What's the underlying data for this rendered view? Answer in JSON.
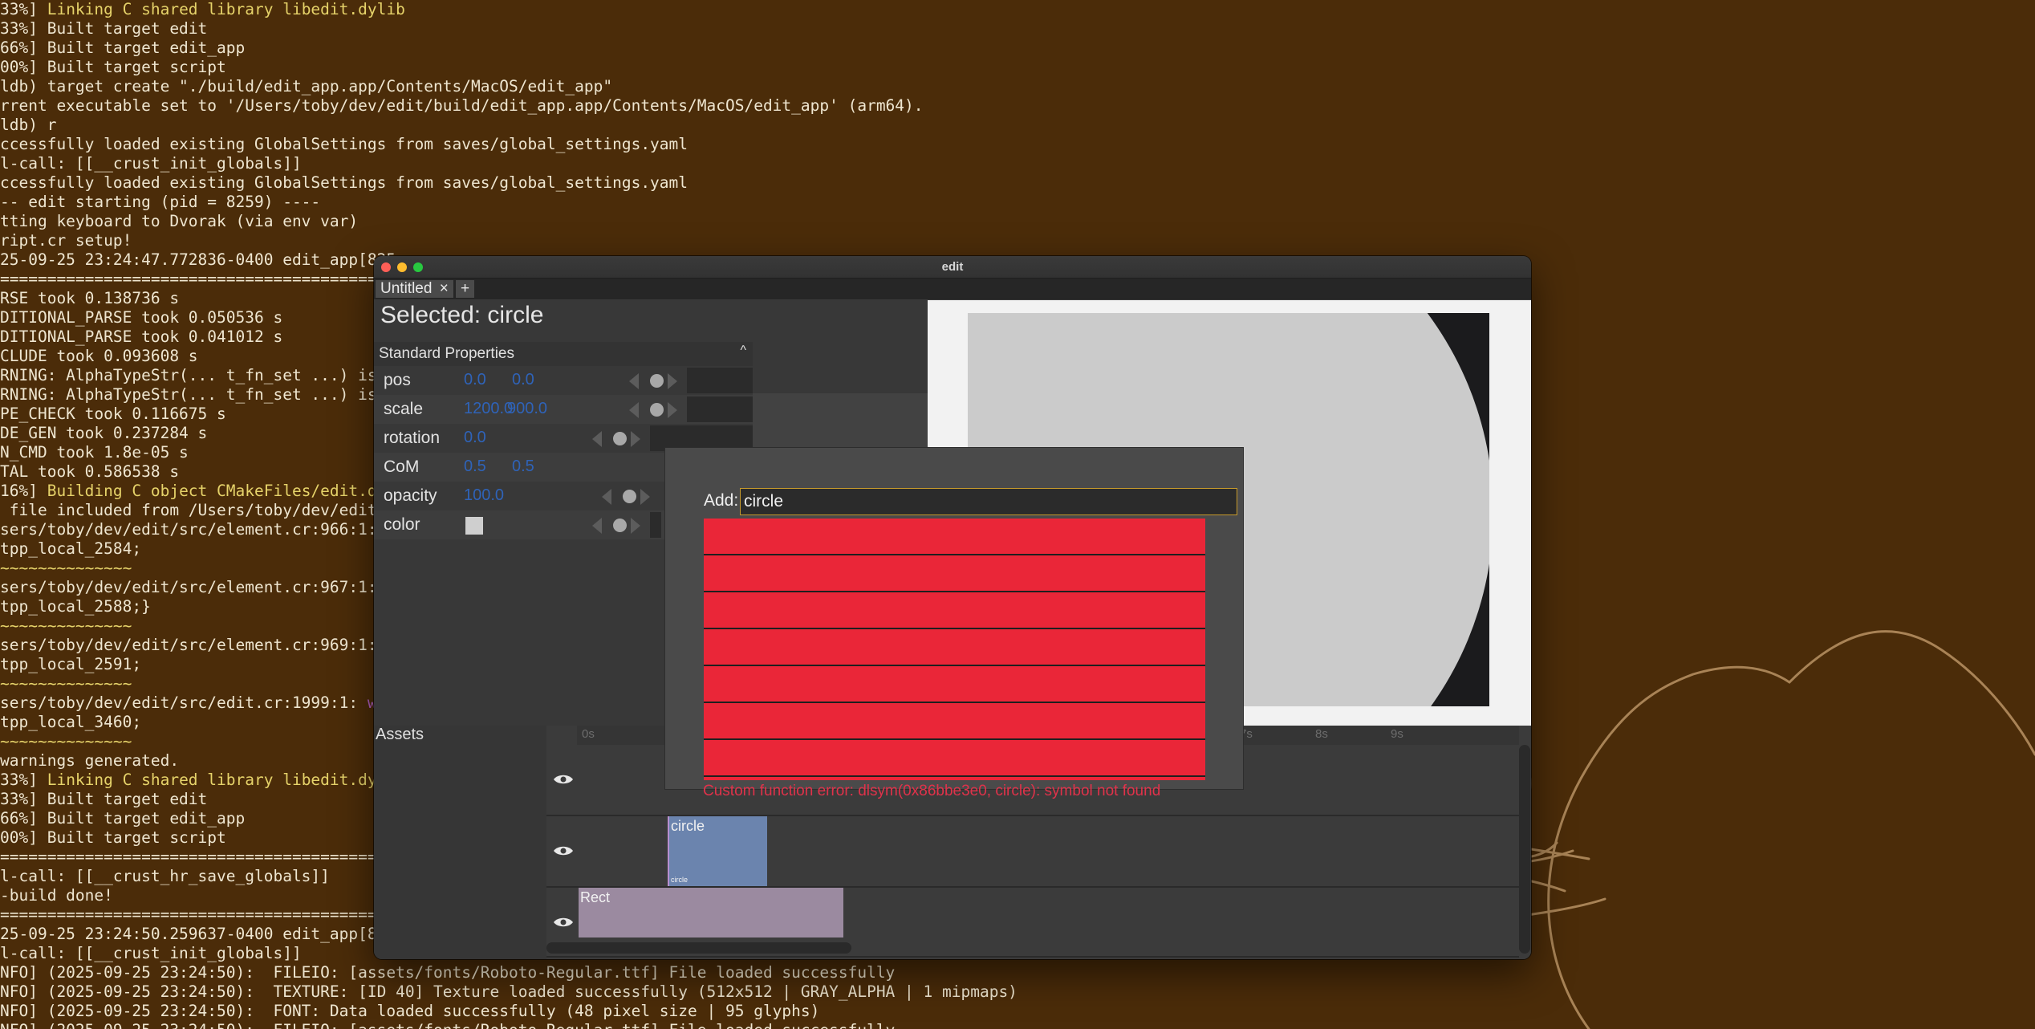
{
  "terminal": {
    "lines": [
      {
        "t": "33%] Linking C shared library libedit.dylib",
        "c": "y",
        "s": 4
      },
      {
        "t": "33%] Built target edit"
      },
      {
        "t": "66%] Built target edit_app"
      },
      {
        "t": "00%] Built target script"
      },
      {
        "t": "ldb) target create \"./build/edit_app.app/Contents/MacOS/edit_app\""
      },
      {
        "t": "rrent executable set to '/Users/toby/dev/edit/build/edit_app.app/Contents/MacOS/edit_app' (arm64)."
      },
      {
        "t": "ldb) r"
      },
      {
        "t": "ccessfully loaded existing GlobalSettings from saves/global_settings.yaml"
      },
      {
        "t": "l-call: [[__crust_init_globals]]"
      },
      {
        "t": "ccessfully loaded existing GlobalSettings from saves/global_settings.yaml"
      },
      {
        "t": "-- edit starting (pid = 8259) ----"
      },
      {
        "t": "tting keyboard to Dvorak (via env var)"
      },
      {
        "t": "ript.cr setup!"
      },
      {
        "t": "25-09-25 23:24:47.772836-0400 edit_app[825"
      },
      {
        "t": "=========================================="
      },
      {
        "t": "RSE took 0.138736 s"
      },
      {
        "t": "DITIONAL_PARSE took 0.050536 s"
      },
      {
        "t": "DITIONAL_PARSE took 0.041012 s"
      },
      {
        "t": "CLUDE took 0.093608 s"
      },
      {
        "t": "RNING: AlphaTypeStr(... t_fn_set ...) is re"
      },
      {
        "t": "RNING: AlphaTypeStr(... t_fn_set ...) is re"
      },
      {
        "t": "PE_CHECK took 0.116675 s"
      },
      {
        "t": "DE_GEN took 0.237284 s"
      },
      {
        "t": "N_CMD took 1.8e-05 s"
      },
      {
        "t": "TAL took 0.586538 s"
      },
      {
        "t": "16%] Building C object CMakeFiles/edit.dir",
        "c": "y",
        "s": 4
      },
      {
        "t": " file included from /Users/toby/dev/edit/o"
      },
      {
        "t": "sers/toby/dev/edit/src/element.cr:966:1: wa",
        "m": 41
      },
      {
        "t": "tpp_local_2584;"
      },
      {
        "t": "~~~~~~~~~~~~~~",
        "c": "y"
      },
      {
        "t": "sers/toby/dev/edit/src/element.cr:967:1: wa",
        "m": 41
      },
      {
        "t": "tpp_local_2588;}"
      },
      {
        "t": "~~~~~~~~~~~~~~",
        "c": "y"
      },
      {
        "t": "sers/toby/dev/edit/src/element.cr:969:1: wa",
        "m": 41
      },
      {
        "t": "tpp_local_2591;"
      },
      {
        "t": "~~~~~~~~~~~~~~",
        "c": "y"
      },
      {
        "t": "sers/toby/dev/edit/src/edit.cr:1999:1: warn",
        "m": 39
      },
      {
        "t": "tpp_local_3460;"
      },
      {
        "t": "~~~~~~~~~~~~~~",
        "c": "y"
      },
      {
        "t": "warnings generated."
      },
      {
        "t": "33%] Linking C shared library libedit.dyli",
        "c": "y",
        "s": 4
      },
      {
        "t": "33%] Built target edit"
      },
      {
        "t": "66%] Built target edit_app"
      },
      {
        "t": "00%] Built target script"
      },
      {
        "t": "=========================================="
      },
      {
        "t": "l-call: [[__crust_hr_save_globals]]"
      },
      {
        "t": "-build done!"
      },
      {
        "t": "=========================================="
      },
      {
        "t": "25-09-25 23:24:50.259637-0400 edit_app[825"
      },
      {
        "t": "l-call: [[__crust_init_globals]]"
      },
      {
        "t": "NFO] (2025-09-25 23:24:50):  FILEIO: [assets/fonts/Roboto-Regular.ttf] File loaded successfully"
      },
      {
        "t": "NFO] (2025-09-25 23:24:50):  TEXTURE: [ID 40] Texture loaded successfully (512x512 | GRAY_ALPHA | 1 mipmaps)"
      },
      {
        "t": "NFO] (2025-09-25 23:24:50):  FONT: Data loaded successfully (48 pixel size | 95 glyphs)"
      },
      {
        "t": "NFO] (2025-09-25 23:24:50):  FILEIO: [assets/fonts/Roboto-Regular.ttf] File loaded successfully"
      }
    ]
  },
  "window": {
    "title": "edit",
    "tabs": {
      "active": "Untitled",
      "close": "×",
      "add": "+"
    },
    "selected_title": "Selected: circle",
    "standard_properties": {
      "header": "Standard Properties",
      "caret": "^",
      "rows": {
        "pos": {
          "label": "pos",
          "v1": "0.0",
          "v2": "0.0"
        },
        "scale": {
          "label": "scale",
          "v1": "1200.0",
          "v2": "900.0"
        },
        "rotation": {
          "label": "rotation",
          "v1": "0.0"
        },
        "com": {
          "label": "CoM",
          "v1": "0.5",
          "v2": "0.5"
        },
        "opacity": {
          "label": "opacity",
          "v1": "100.0"
        },
        "color": {
          "label": "color",
          "swatch": "#cfcfcf"
        }
      }
    },
    "assets_label": "Assets",
    "timeline": {
      "ticks": [
        "0s",
        "7s",
        "8s",
        "9s"
      ],
      "clips": {
        "circle": "circle",
        "circle_small": "circle",
        "rect": "Rect"
      }
    },
    "add_popup": {
      "label": "Add:",
      "value": "circle",
      "result_count": 8,
      "error": "Custom function error: dlsym(0x86bbe3e0, circle): symbol not found"
    }
  },
  "colors": {
    "terminal_bg": "#4b2c09",
    "result_red": "#ea2638",
    "value_blue": "#2f63b8",
    "error_red": "#e0324a",
    "input_border": "#c79a2b"
  }
}
